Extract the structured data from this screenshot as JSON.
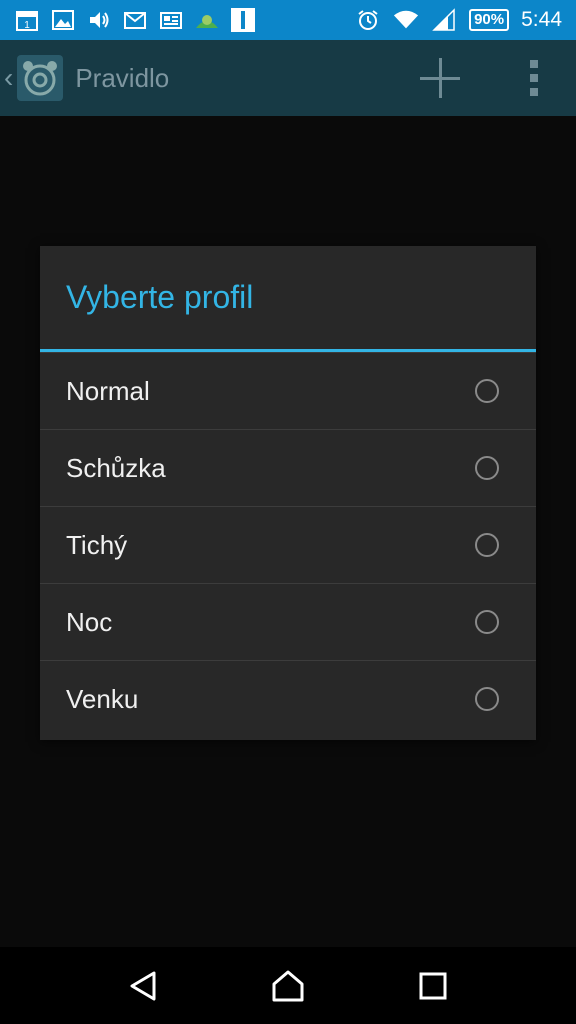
{
  "status_bar": {
    "calendar_day": "1",
    "battery": "90%",
    "time": "5:44",
    "icons": [
      "calendar-icon",
      "gallery-icon",
      "volume-icon",
      "gmail-icon",
      "news-icon",
      "weather-icon",
      "app-icon",
      "alarm-icon",
      "wifi-icon",
      "signal-icon",
      "battery-icon"
    ]
  },
  "action_bar": {
    "title": "Pravidlo",
    "back_glyph": "‹"
  },
  "dialog": {
    "title": "Vyberte profil",
    "options": [
      {
        "label": "Normal"
      },
      {
        "label": "Schůzka"
      },
      {
        "label": "Tichý"
      },
      {
        "label": "Noc"
      },
      {
        "label": "Venku"
      }
    ]
  },
  "colors": {
    "status_bar": "#0c86c9",
    "accent": "#33b5e5",
    "dialog_bg": "#282828"
  }
}
